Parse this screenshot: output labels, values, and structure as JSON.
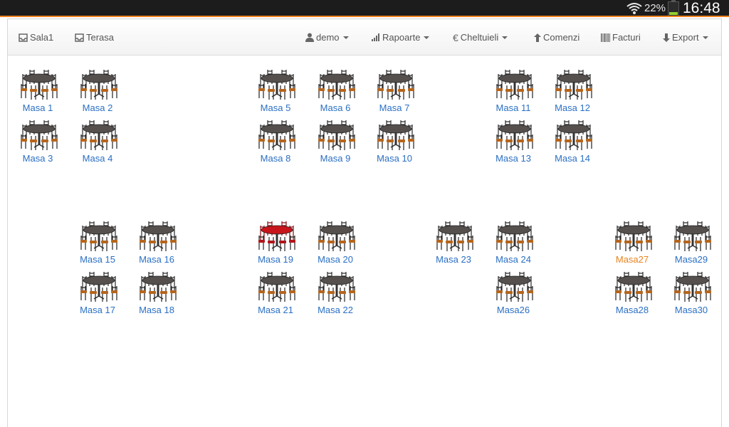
{
  "status_bar": {
    "battery_percent": "22%",
    "battery_level": 0.22,
    "time": "16:48",
    "icons": [
      "wifi-icon",
      "battery-icon"
    ]
  },
  "nav": {
    "sala1": "Sala1",
    "terasa": "Terasa",
    "user": "demo",
    "rapoarte": "Rapoarte",
    "cheltuieli": "Cheltuieli",
    "comenzi": "Comenzi",
    "facturi": "Facturi",
    "export": "Export"
  },
  "colors": {
    "accent": "#f0831f",
    "link": "#2a6fc4",
    "occupied_table": "#c8151b",
    "highlight_label": "#e8821f"
  },
  "tables": [
    {
      "label": "Masa 1"
    },
    {
      "label": "Masa 2"
    },
    {
      "label": "Masa 3"
    },
    {
      "label": "Masa 4"
    },
    {
      "label": "Masa 5"
    },
    {
      "label": "Masa 6"
    },
    {
      "label": "Masa 7"
    },
    {
      "label": "Masa 8"
    },
    {
      "label": "Masa 9"
    },
    {
      "label": "Masa 10"
    },
    {
      "label": "Masa 11"
    },
    {
      "label": "Masa 12"
    },
    {
      "label": "Masa 13"
    },
    {
      "label": "Masa 14"
    },
    {
      "label": "Masa 15"
    },
    {
      "label": "Masa 16"
    },
    {
      "label": "Masa 17"
    },
    {
      "label": "Masa 18"
    },
    {
      "label": "Masa 19",
      "occupied": true
    },
    {
      "label": "Masa 20"
    },
    {
      "label": "Masa 21"
    },
    {
      "label": "Masa 22"
    },
    {
      "label": "Masa 23"
    },
    {
      "label": "Masa 24"
    },
    {
      "label": "Masa26"
    },
    {
      "label": "Masa27",
      "highlighted": true
    },
    {
      "label": "Masa29"
    },
    {
      "label": "Masa28"
    },
    {
      "label": "Masa30"
    }
  ]
}
